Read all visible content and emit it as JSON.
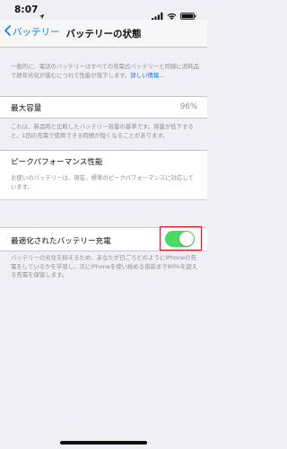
{
  "status_bar": {
    "time": "8:07",
    "icons": [
      "location-arrow-icon",
      "signal-bars-icon",
      "wifi-icon",
      "battery-icon"
    ]
  },
  "nav": {
    "back_label": "バッテリー",
    "title": "バッテリーの状態"
  },
  "intro": {
    "text": "一般的に、電話のバッテリーはすべての充電式バッテリーと同様に消耗品で経年劣化が進むにつれて性能が低下します。",
    "link": "詳しい情報..."
  },
  "max_capacity": {
    "label": "最大容量",
    "value": "96%",
    "description": "これは、新品時と比較したバッテリー容量の基準です。容量が低下すると、1回の充電で使用できる時間が短くなることがあります。"
  },
  "peak_performance": {
    "label": "ピークパフォーマンス性能",
    "description": "お使いのバッテリーは、現在、標準のピークパフォーマンスに対応しています。"
  },
  "optimized_charging": {
    "label": "最適化されたバッテリー充電",
    "enabled": true,
    "description": "バッテリーの劣化を抑えるため、あなたが日ごろどのようにiPhoneの充電をしているかを学習し、次にiPhoneを使い始める直前まで80%を超える充電を保留します。"
  },
  "colors": {
    "accent": "#007aff",
    "toggle_on": "#4cd964",
    "highlight": "#e0121b"
  }
}
